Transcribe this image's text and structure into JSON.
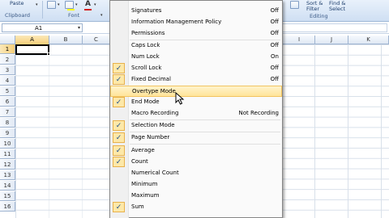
{
  "ribbon": {
    "paste_label": "Paste",
    "clipboard_label": "Clipboard",
    "font_label": "Font",
    "sort_filter_label": "Sort &",
    "sort_filter_sub": "Filter",
    "find_select_label": "Find &",
    "find_select_sub": "Select",
    "editing_label": "Editing"
  },
  "formula_bar": {
    "name_box": "A1",
    "formula": ""
  },
  "grid": {
    "columns": [
      "A",
      "B",
      "C",
      "I",
      "J",
      "K"
    ],
    "rows": [
      "1",
      "2",
      "3",
      "4",
      "5",
      "6",
      "7",
      "8",
      "9",
      "10",
      "11",
      "12",
      "13",
      "14",
      "15",
      "16"
    ]
  },
  "menu": {
    "items": [
      {
        "label": "Signatures",
        "value": "Off",
        "checked": false
      },
      {
        "label": "Information Management Policy",
        "value": "Off",
        "checked": false
      },
      {
        "label": "Permissions",
        "value": "Off",
        "checked": false
      },
      {
        "label": "Caps Lock",
        "value": "Off",
        "checked": false
      },
      {
        "label": "Num Lock",
        "value": "On",
        "checked": false
      },
      {
        "label": "Scroll Lock",
        "value": "Off",
        "checked": true
      },
      {
        "label": "Fixed Decimal",
        "value": "Off",
        "checked": true
      },
      {
        "label": "Overtype Mode",
        "value": "",
        "checked": false
      },
      {
        "label": "End Mode",
        "value": "",
        "checked": true
      },
      {
        "label": "Macro Recording",
        "value": "Not Recording",
        "checked": false
      },
      {
        "label": "Selection Mode",
        "value": "",
        "checked": true
      },
      {
        "label": "Page Number",
        "value": "",
        "checked": true
      },
      {
        "label": "Average",
        "value": "",
        "checked": true
      },
      {
        "label": "Count",
        "value": "",
        "checked": true
      },
      {
        "label": "Numerical Count",
        "value": "",
        "checked": false
      },
      {
        "label": "Minimum",
        "value": "",
        "checked": false
      },
      {
        "label": "Maximum",
        "value": "",
        "checked": false
      },
      {
        "label": "Sum",
        "value": "",
        "checked": true
      }
    ],
    "hover_index": 7,
    "check_glyph": "✓"
  }
}
